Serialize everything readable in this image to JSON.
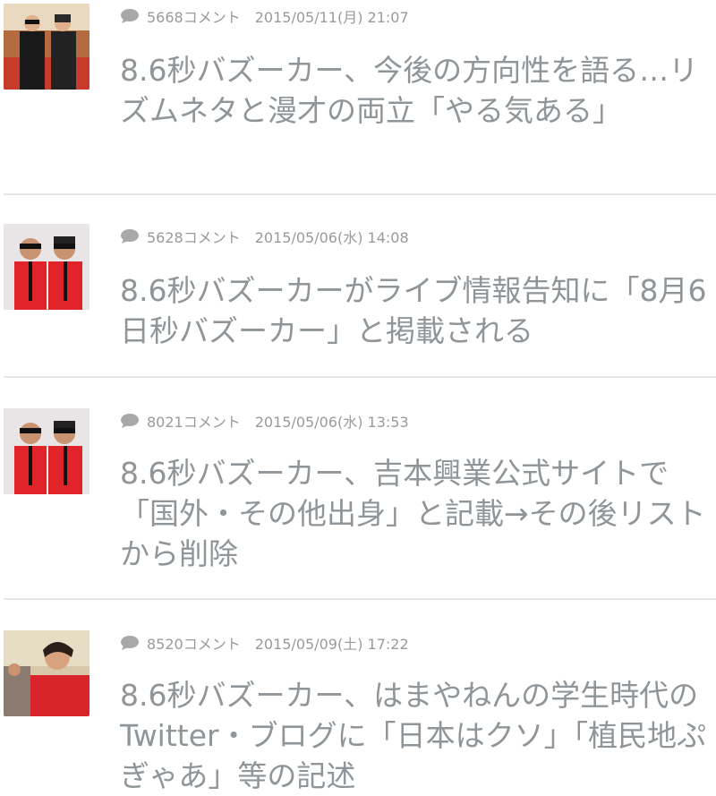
{
  "articles": [
    {
      "comments": "5668コメント",
      "datetime": "2015/05/11(月) 21:07",
      "title": "8.6秒バズーカー、今後の方向性を語る…リズムネタと漫才の両立「やる気ある」",
      "thumbnail_icon": "duo-black-suits-photo"
    },
    {
      "comments": "5628コメント",
      "datetime": "2015/05/06(水) 14:08",
      "title": "8.6秒バズーカーがライブ情報告知に「8月6日秒バズーカー」と掲載される",
      "thumbnail_icon": "duo-red-shirts-photo"
    },
    {
      "comments": "8021コメント",
      "datetime": "2015/05/06(水) 13:53",
      "title": "8.6秒バズーカー、吉本興業公式サイトで「国外・その他出身」と記載→その後リストから削除",
      "thumbnail_icon": "duo-red-shirts-photo"
    },
    {
      "comments": "8520コメント",
      "datetime": "2015/05/09(土) 17:22",
      "title": "8.6秒バズーカー、はまやねんの学生時代のTwitter・ブログに「日本はクソ」「植民地ぷぎゃあ」等の記述",
      "thumbnail_icon": "red-shirt-portrait-photo"
    }
  ],
  "colors": {
    "title": "#8f9598",
    "meta": "#9a9a9a",
    "divider": "#e6e6e6"
  }
}
